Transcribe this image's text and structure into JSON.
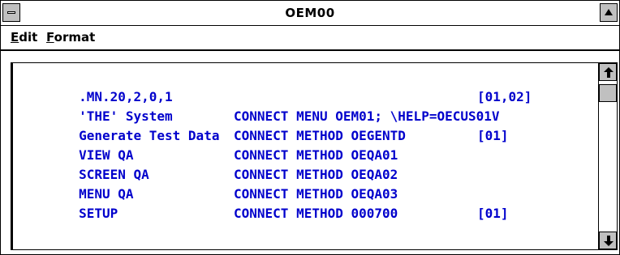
{
  "window": {
    "title": "OEM00"
  },
  "menu": {
    "items": [
      {
        "accel": "E",
        "rest": "dit"
      },
      {
        "accel": "F",
        "rest": "ormat"
      }
    ]
  },
  "editor": {
    "text_color": "#0000cc",
    "lines": [
      {
        "name": ".MN.20,2,0,1",
        "command": "",
        "tag": "[01,02]"
      },
      {
        "name": "'THE' System",
        "command": "CONNECT MENU OEM01; \\HELP=OECUS01V",
        "tag": ""
      },
      {
        "name": "Generate Test Data",
        "command": "CONNECT METHOD OEGENTD",
        "tag": "[01]"
      },
      {
        "name": "VIEW QA",
        "command": "CONNECT METHOD OEQA01",
        "tag": ""
      },
      {
        "name": "SCREEN QA",
        "command": "CONNECT METHOD OEQA02",
        "tag": ""
      },
      {
        "name": "MENU QA",
        "command": "CONNECT METHOD OEQA03",
        "tag": ""
      },
      {
        "name": "SETUP",
        "command": "CONNECT METHOD 000700",
        "tag": "[01]"
      }
    ]
  },
  "icons": {
    "system_menu": "system-menu-icon",
    "maximize": "maximize-icon",
    "scroll_up": "scroll-up-arrow-icon",
    "scroll_down": "scroll-down-arrow-icon"
  }
}
